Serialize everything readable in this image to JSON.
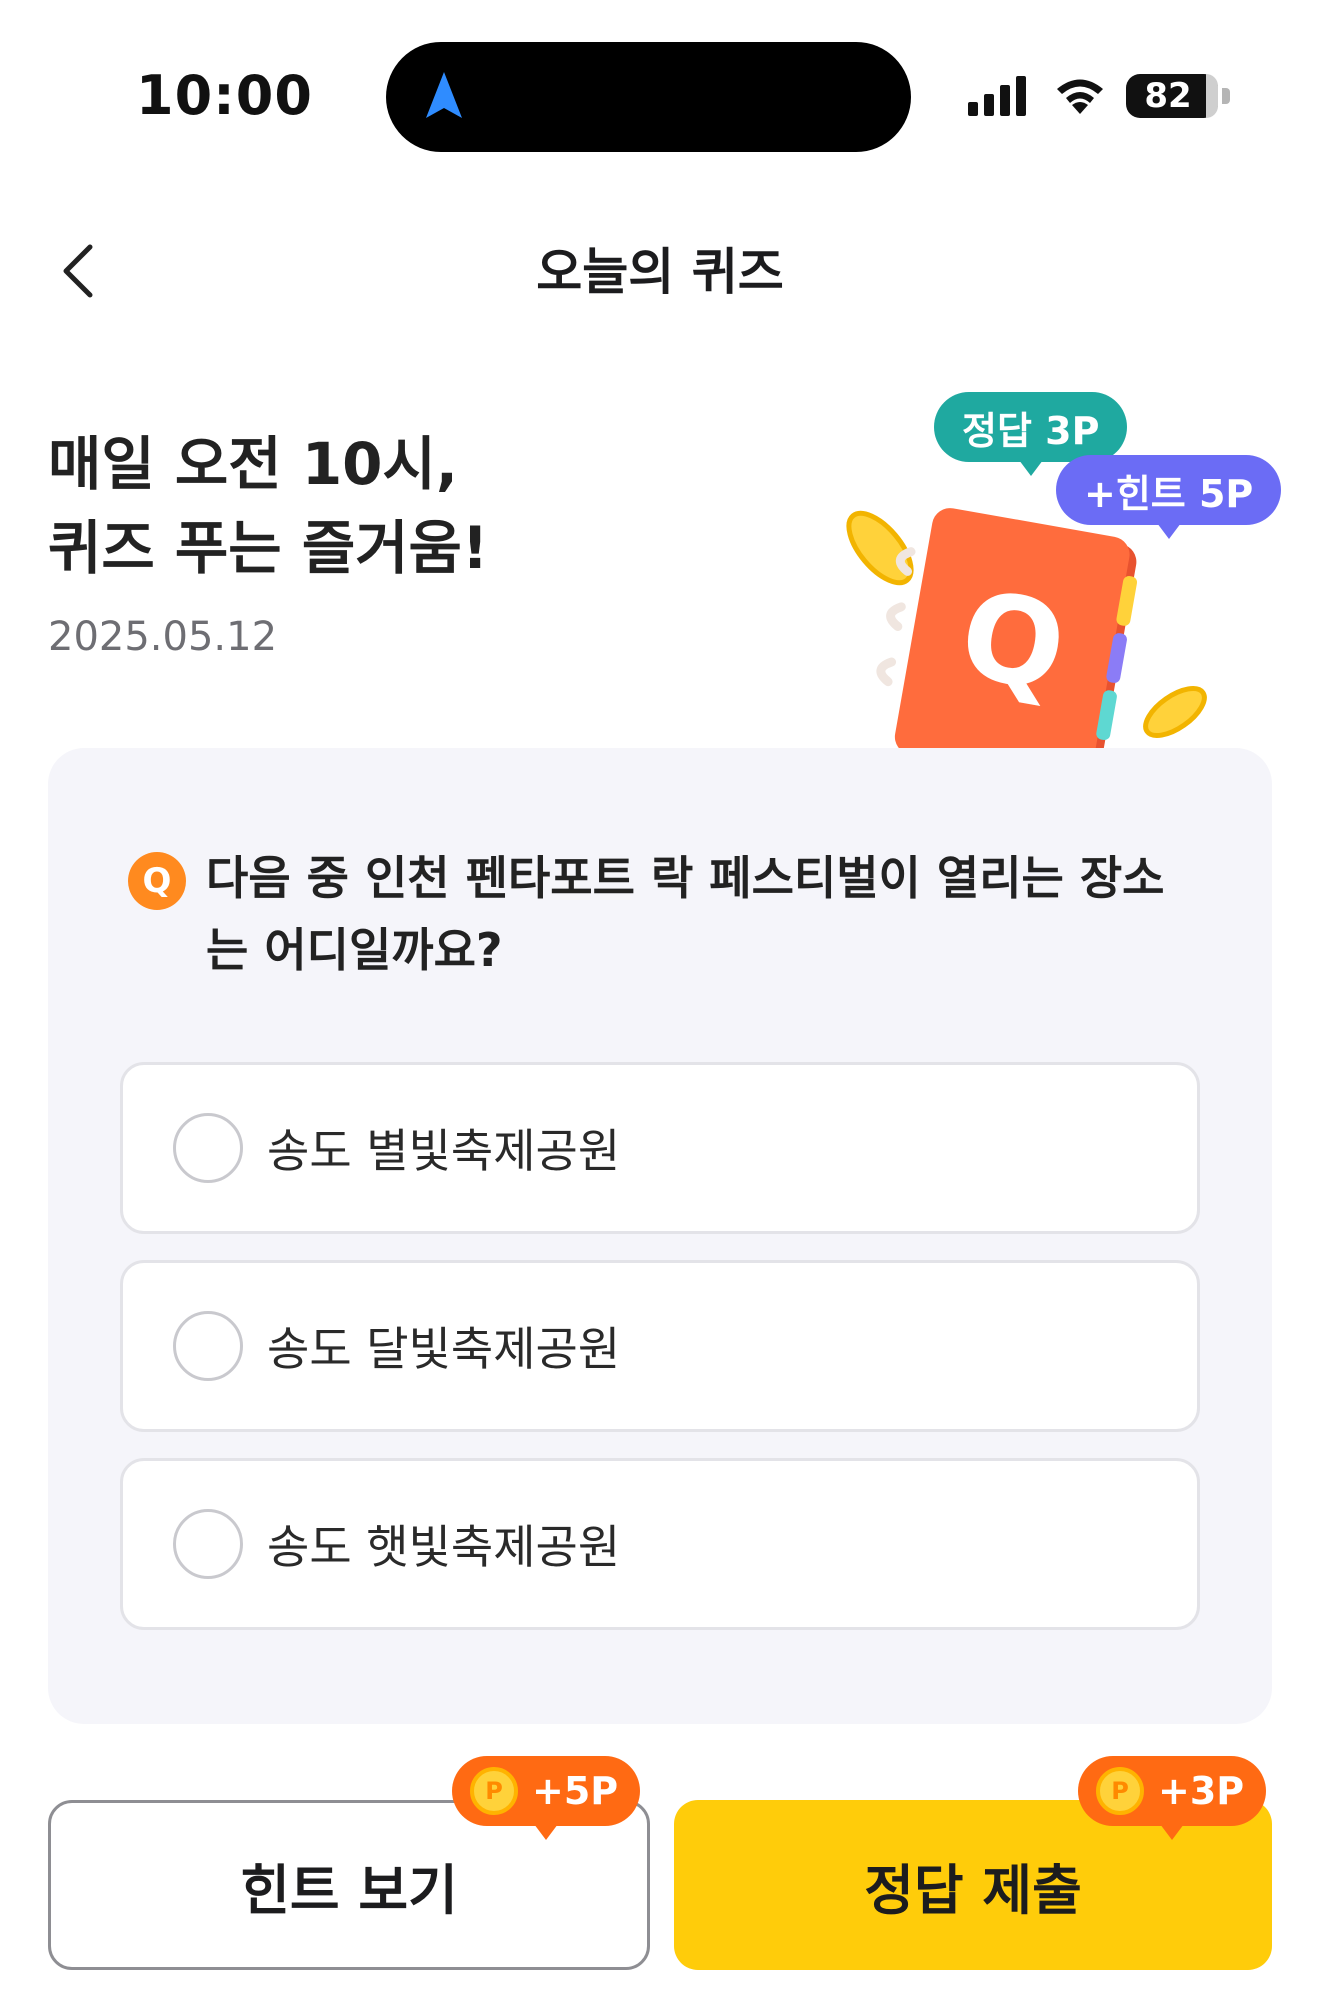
{
  "status_bar": {
    "time": "10:00",
    "battery": "82"
  },
  "header": {
    "title": "오늘의 퀴즈"
  },
  "hero": {
    "title_line1": "매일 오전 10시,",
    "title_line2": "퀴즈 푸는 즐거움!",
    "date": "2025.05.12",
    "bubble_correct": "정답 3P",
    "bubble_hint": "+힌트 5P",
    "illustration_letter": "Q"
  },
  "quiz": {
    "badge": "Q",
    "question": "다음 중 인천 펜타포트 락 페스티벌이 열리는 장소는 어디일까요?",
    "options": [
      {
        "label": "송도 별빛축제공원"
      },
      {
        "label": "송도 달빛축제공원"
      },
      {
        "label": "송도 햇빛축제공원"
      }
    ]
  },
  "actions": {
    "hint_label": "힌트 보기",
    "hint_reward": "+5P",
    "submit_label": "정답 제출",
    "submit_reward": "+3P",
    "coin_symbol": "P"
  },
  "colors": {
    "submit_button": "#ffcc0a",
    "reward_badge": "#ff6a13",
    "question_badge": "#ff8a1f",
    "bubble_correct": "#1fa9a0",
    "bubble_hint": "#6b6cf5"
  }
}
